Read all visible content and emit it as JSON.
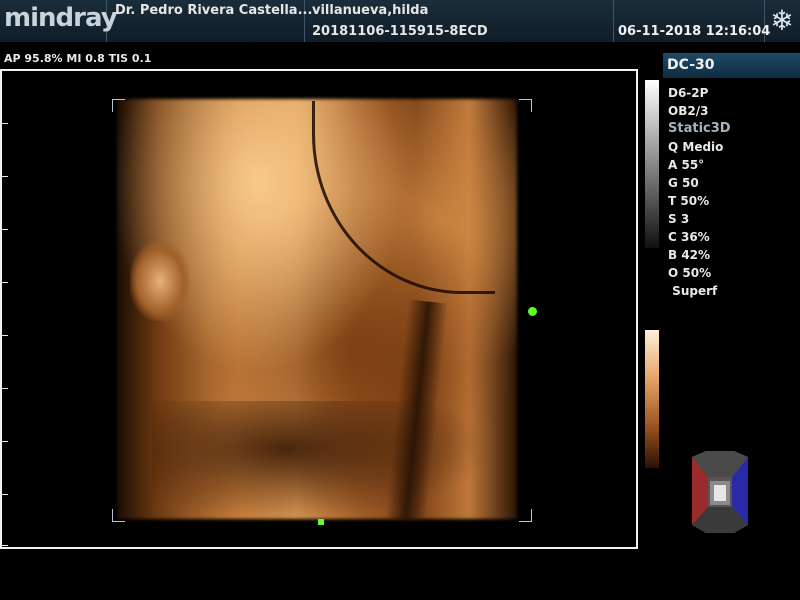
{
  "header": {
    "logo": "mindray",
    "doctor": "Dr. Pedro Rivera Castella...",
    "patient_name": "villanueva,hilda",
    "exam_id": "20181106-115915-8ECD",
    "datetime": "06-11-2018  12:16:04",
    "freeze_icon": "snowflake-icon"
  },
  "acoustic": "AP 95.8%  MI 0.8 TIS 0.1",
  "panel": {
    "probe_mode": "DC-30",
    "params": [
      "D6-2P",
      "OB2/3",
      "Static3D",
      "Q Medio",
      "A 55°",
      "G 50",
      "T 50%",
      "S 3",
      "C 36%",
      "B 42%",
      "O 50%",
      " Superf"
    ]
  },
  "colors": {
    "header_bg": "#1b2d3a",
    "probe_title_bg": "#1d4a68",
    "marker_green": "#5cff2a",
    "render_amber": "#c77f3d"
  }
}
